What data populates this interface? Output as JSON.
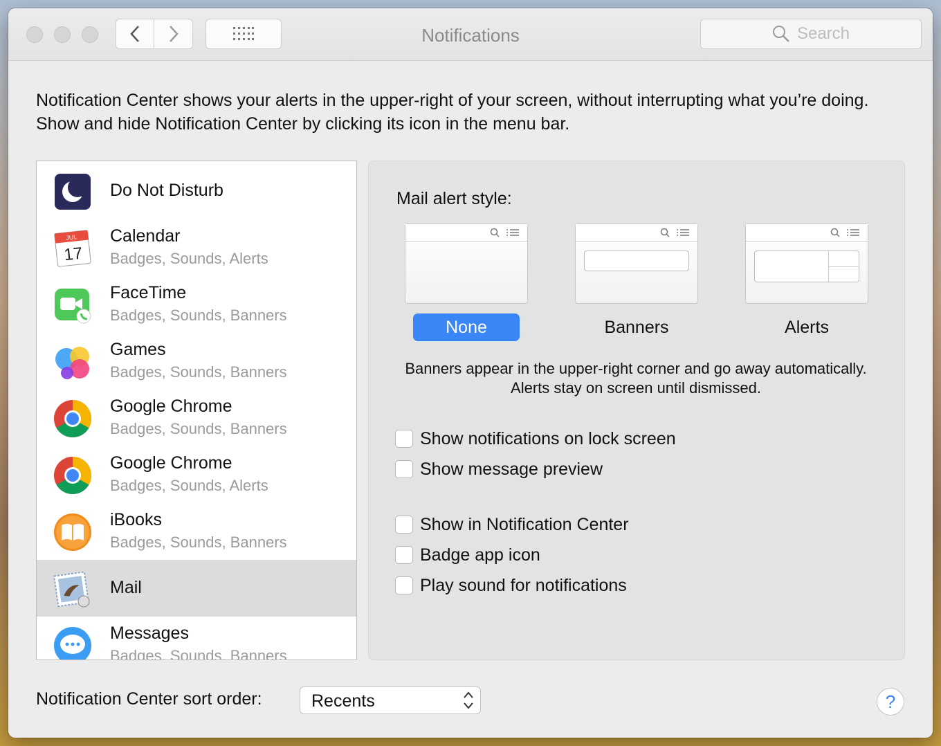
{
  "window": {
    "title": "Notifications",
    "search_placeholder": "Search"
  },
  "intro_text": "Notification Center shows your alerts in the upper-right of your screen, without interrupting what you’re doing. Show and hide Notification Center by clicking its icon in the menu bar.",
  "apps": [
    {
      "name": "Do Not Disturb",
      "subtitle": "",
      "icon": "moon-icon"
    },
    {
      "name": "Calendar",
      "subtitle": "Badges, Sounds, Alerts",
      "icon": "calendar-icon",
      "calendar_month": "JUL",
      "calendar_day": "17"
    },
    {
      "name": "FaceTime",
      "subtitle": "Badges, Sounds, Banners",
      "icon": "facetime-icon"
    },
    {
      "name": "Games",
      "subtitle": "Badges, Sounds, Banners",
      "icon": "game-center-icon"
    },
    {
      "name": "Google Chrome",
      "subtitle": "Badges, Sounds, Banners",
      "icon": "chrome-icon"
    },
    {
      "name": "Google Chrome",
      "subtitle": "Badges, Sounds, Alerts",
      "icon": "chrome-icon"
    },
    {
      "name": "iBooks",
      "subtitle": "Badges, Sounds, Banners",
      "icon": "ibooks-icon"
    },
    {
      "name": "Mail",
      "subtitle": "",
      "icon": "mail-icon",
      "selected": true
    },
    {
      "name": "Messages",
      "subtitle": "Badges, Sounds, Banners",
      "icon": "messages-icon"
    }
  ],
  "panel": {
    "alert_style_label": "Mail alert style:",
    "styles": [
      {
        "label": "None",
        "selected": true
      },
      {
        "label": "Banners",
        "selected": false
      },
      {
        "label": "Alerts",
        "selected": false
      }
    ],
    "description": "Banners appear in the upper-right corner and go away automatically. Alerts stay on screen until dismissed.",
    "checkboxes": [
      {
        "label": "Show notifications on lock screen",
        "checked": false
      },
      {
        "label": "Show message preview",
        "checked": false
      },
      {
        "label": "Show in Notification Center",
        "checked": false
      },
      {
        "label": "Badge app icon",
        "checked": false
      },
      {
        "label": "Play sound for notifications",
        "checked": false
      }
    ]
  },
  "footer": {
    "sort_label": "Notification Center sort order:",
    "sort_value": "Recents",
    "help_label": "?"
  },
  "colors": {
    "accent": "#3b86f7",
    "window_bg": "#ececec",
    "selected_row": "#dcdcdc"
  }
}
